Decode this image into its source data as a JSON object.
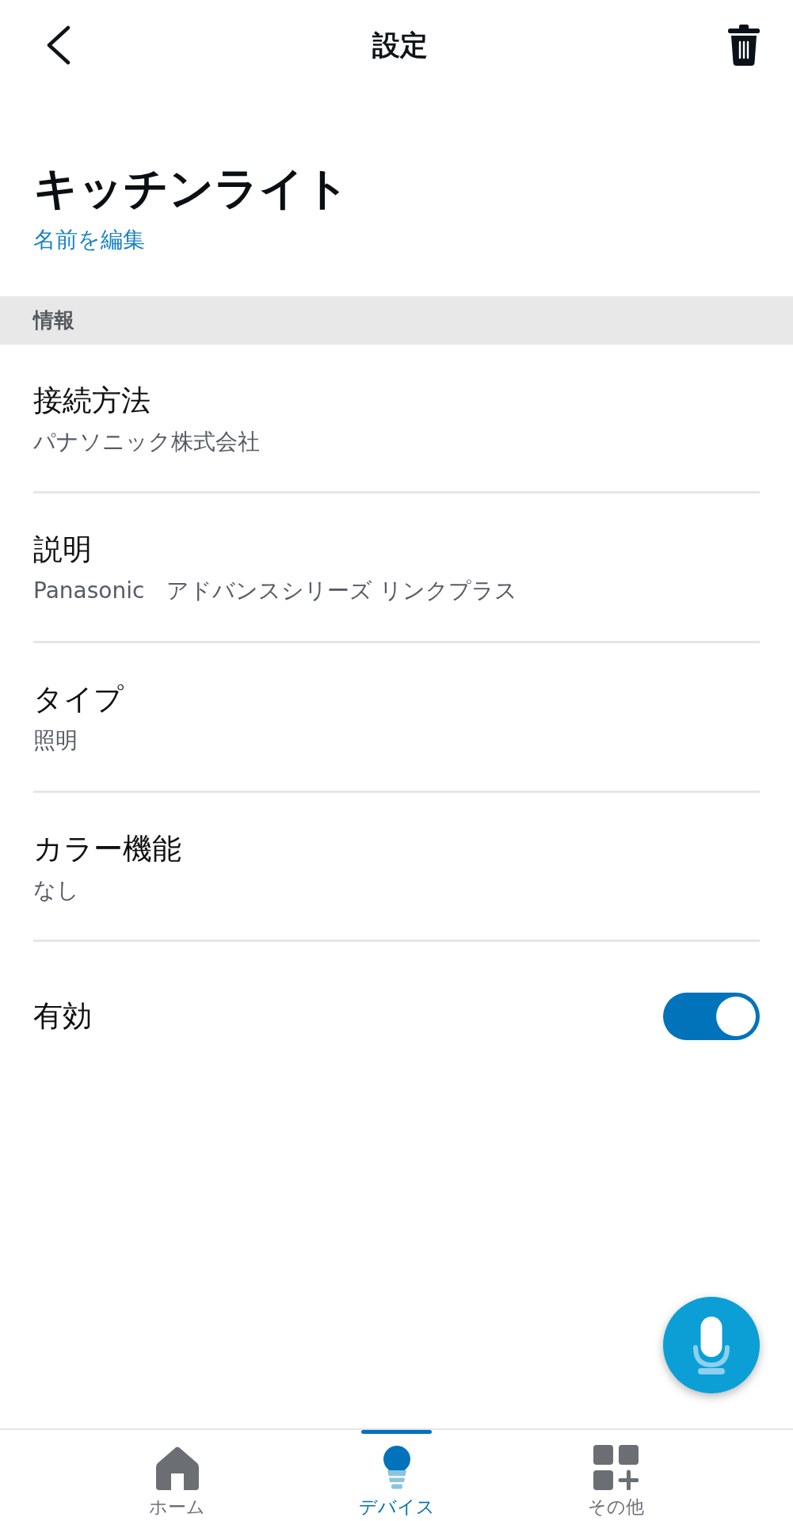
{
  "header": {
    "title": "設定"
  },
  "device": {
    "name": "キッチンライト",
    "edit_link": "名前を編集"
  },
  "section": {
    "title": "情報"
  },
  "info_rows": [
    {
      "label": "接続方法",
      "value": "パナソニック株式会社"
    },
    {
      "label": "説明",
      "value": "Panasonic　アドバンスシリーズ リンクプラス"
    },
    {
      "label": "タイプ",
      "value": "照明"
    },
    {
      "label": "カラー機能",
      "value": "なし"
    }
  ],
  "enabled": {
    "label": "有効",
    "on": true
  },
  "bottom_nav": [
    {
      "kind": "home",
      "label": "ホーム",
      "selected": false
    },
    {
      "kind": "devices",
      "label": "デバイス",
      "selected": true
    },
    {
      "kind": "more",
      "label": "その他",
      "selected": false
    }
  ]
}
